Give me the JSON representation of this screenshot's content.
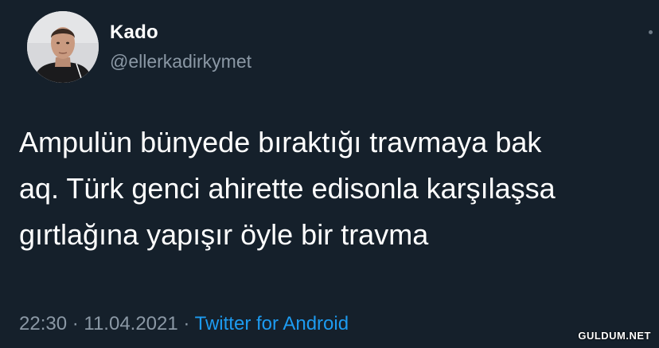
{
  "tweet": {
    "author_name": "Kado",
    "author_handle": "@ellerkadirkymet",
    "text_lines": [
      "Ampulün bünyede bıraktığı travmaya bak",
      "aq. Türk genci ahirette edisonla karşılaşsa",
      "gırtlağına yapışır öyle bir travma"
    ],
    "time": "22:30",
    "separator": " · ",
    "date": "11.04.2021",
    "source": "Twitter for Android"
  },
  "watermark": "GULDUM.NET",
  "colors": {
    "background": "#15202b",
    "text": "#ffffff",
    "secondary": "#8b98a5",
    "link": "#1d9bf0"
  },
  "icons": {
    "avatar": "profile-photo",
    "menu": "more-dot-icon"
  }
}
